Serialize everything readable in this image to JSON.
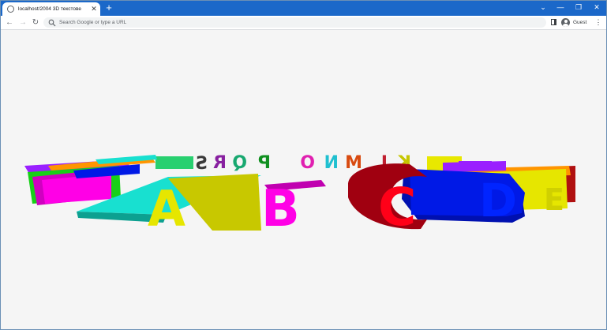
{
  "tab": {
    "title": "localhost/2004 3D текстове",
    "close_glyph": "✕"
  },
  "new_tab_glyph": "+",
  "window_controls": {
    "chevron": "⌄",
    "minimize": "—",
    "restore": "❐",
    "close": "✕"
  },
  "nav": {
    "back": "←",
    "forward": "→",
    "reload": "↻"
  },
  "omnibox": {
    "placeholder": "Search Google or type a URL"
  },
  "profile": {
    "name": "Guest"
  },
  "menu_glyph": "⋮",
  "scene": {
    "front_letters": [
      "A",
      "B",
      "C",
      "D",
      "E"
    ],
    "back_letters": [
      "K",
      "L",
      "M",
      "N",
      "O",
      "P",
      "Q",
      "R",
      "S"
    ],
    "letter_colors": {
      "yellow": "#e6e600",
      "magenta": "#ff00e6",
      "red": "#e6001a",
      "blue": "#0019e6",
      "cyan": "#18e0d0",
      "green": "#18d018",
      "purple": "#9a20ff",
      "orange": "#ff9500"
    }
  }
}
